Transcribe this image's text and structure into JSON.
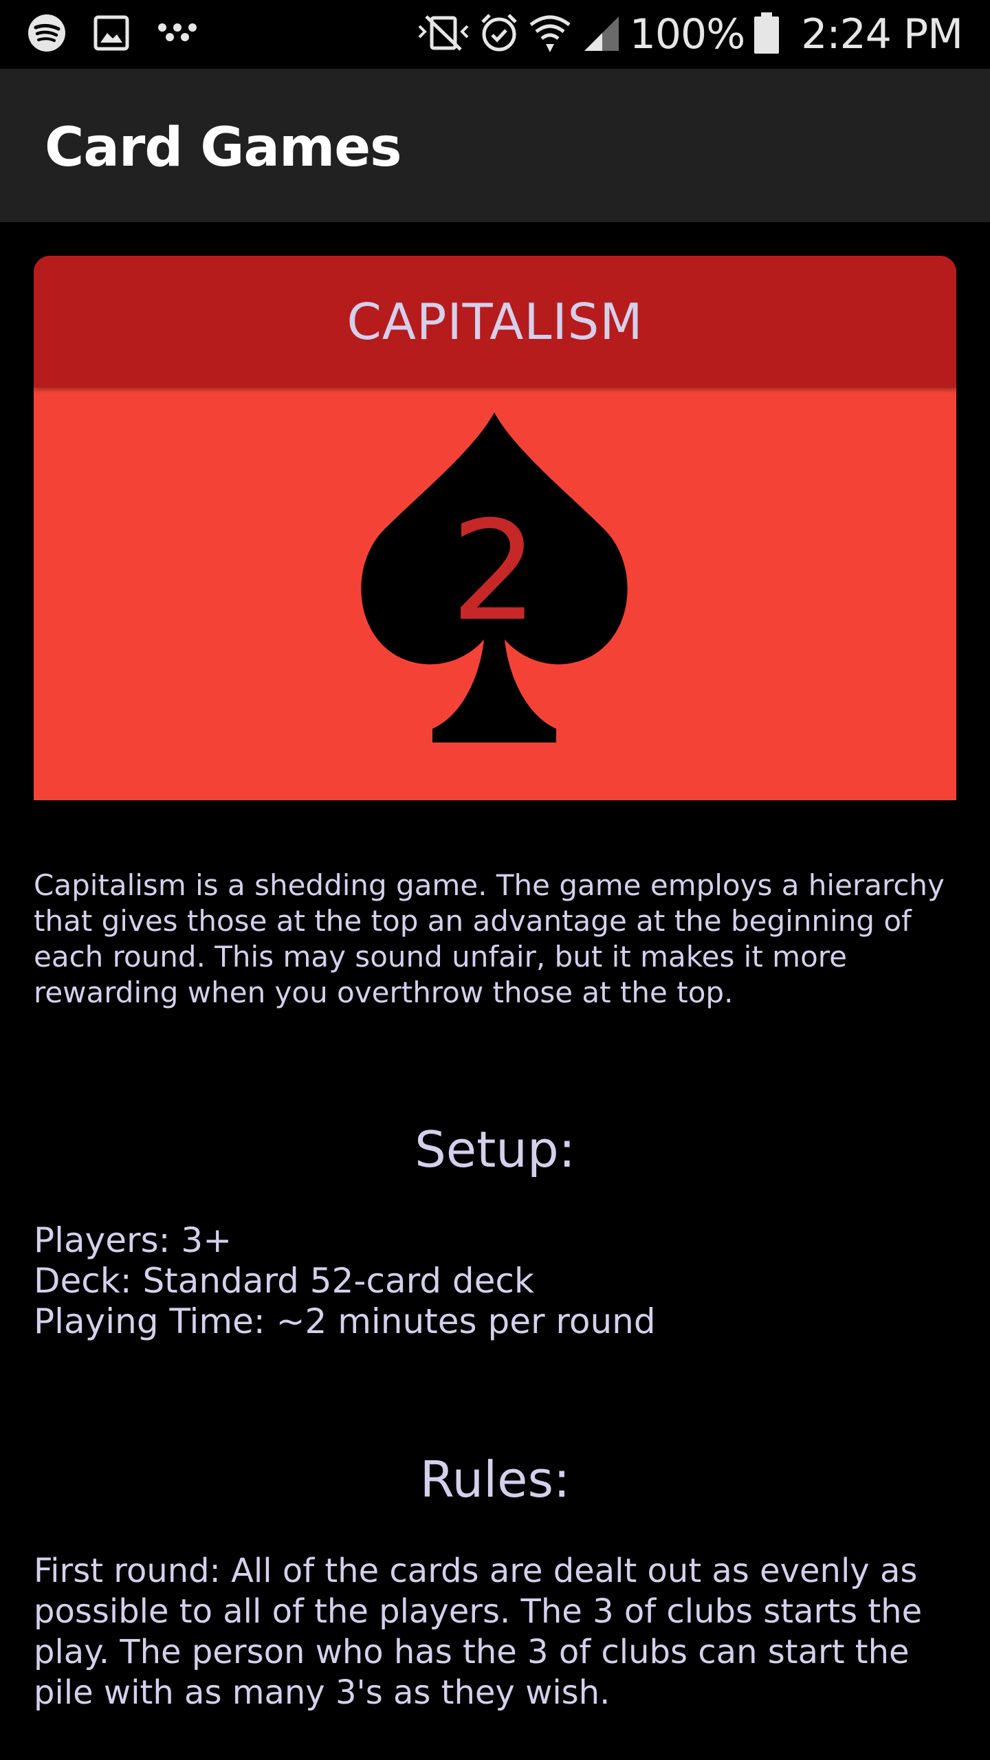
{
  "status_bar": {
    "battery": "100%",
    "time": "2:24 PM",
    "left_icons": [
      "spotify-icon",
      "gallery-icon",
      "dots-app-icon"
    ],
    "right_icons": [
      "vibrate-icon",
      "alarm-icon",
      "wifi-icon",
      "signal-icon",
      "battery-icon"
    ]
  },
  "app_bar": {
    "title": "Card Games"
  },
  "card": {
    "title": "CAPITALISM",
    "image_label": "2",
    "colors": {
      "header": "#b71c1c",
      "body": "#f44336",
      "label": "#c62828"
    }
  },
  "description": "Capitalism is a shedding game. The game employs a hierarchy that gives those at the top an advantage at the beginning of each round. This may sound unfair, but it makes it more rewarding when you overthrow those at the top.",
  "setup": {
    "heading": "Setup:",
    "items": [
      "Players: 3+",
      "Deck: Standard 52-card deck",
      "Playing Time: ~2 minutes per round"
    ]
  },
  "rules": {
    "heading": "Rules:",
    "first_paragraph": "First round: All of the cards are dealt out as evenly as possible to all of the players. The 3 of clubs starts the play. The person who has the 3 of clubs can start the pile with as many 3's as they wish."
  }
}
